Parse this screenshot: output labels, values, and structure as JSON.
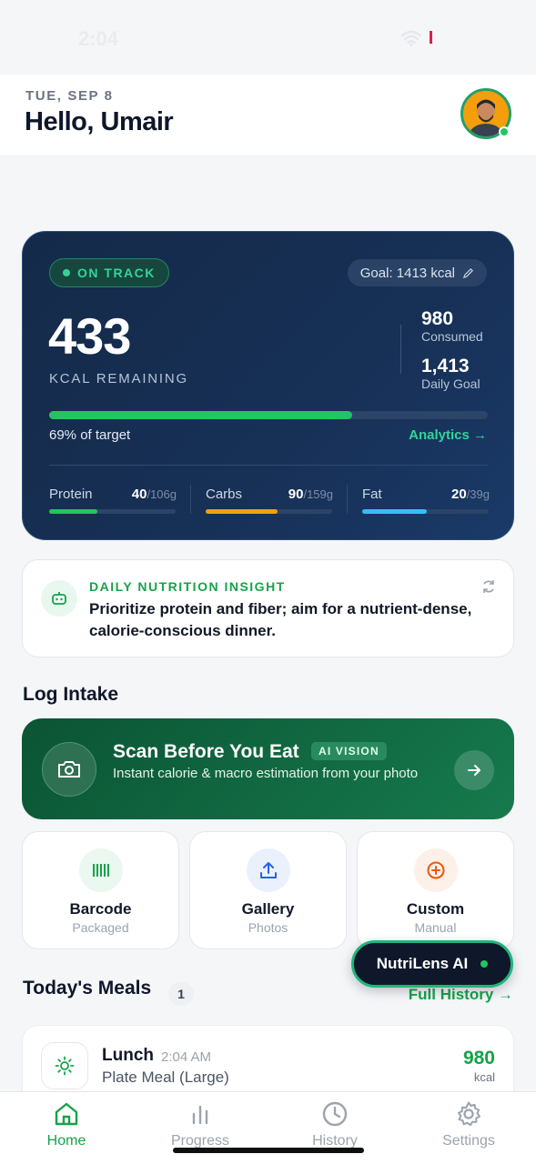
{
  "status": {
    "time": "2:04"
  },
  "header": {
    "date": "TUE, SEP 8",
    "greeting": "Hello, Umair"
  },
  "summary": {
    "status_badge": "ON TRACK",
    "goal_chip": "Goal: 1413 kcal",
    "remaining": "433",
    "remaining_label": "KCAL REMAINING",
    "consumed_value": "980",
    "consumed_label": "Consumed",
    "goal_value": "1,413",
    "goal_label": "Daily Goal",
    "progress_fraction": 0.69,
    "progress_label": "69% of target",
    "analytics_link": "Analytics →",
    "macros": [
      {
        "name": "Protein",
        "value": "40",
        "target": "/106g",
        "fraction": 0.38,
        "color": "#22c55e"
      },
      {
        "name": "Carbs",
        "value": "90",
        "target": "/159g",
        "fraction": 0.57,
        "color": "#f59e0b"
      },
      {
        "name": "Fat",
        "value": "20",
        "target": "/39g",
        "fraction": 0.51,
        "color": "#38bdf8"
      }
    ]
  },
  "insight": {
    "title": "DAILY NUTRITION INSIGHT",
    "text": "Prioritize protein and fiber; aim for a nutrient-dense, calorie-conscious dinner."
  },
  "log_intake": {
    "title": "Log Intake",
    "scan_title": "Scan Before You Eat",
    "scan_badge": "AI VISION",
    "scan_subtitle": "Instant calorie & macro estimation from your photo",
    "options": [
      {
        "title": "Barcode",
        "subtitle": "Packaged",
        "icon": "barcode-icon",
        "bg": "#eaf8ef",
        "color": "#16a34a"
      },
      {
        "title": "Gallery",
        "subtitle": "Photos",
        "icon": "upload-icon",
        "bg": "#eaf1fd",
        "color": "#2563eb"
      },
      {
        "title": "Custom",
        "subtitle": "Manual",
        "icon": "plus-circle-icon",
        "bg": "#fdf0e8",
        "color": "#ea580c"
      }
    ]
  },
  "assistant_button": "NutriLens AI",
  "meals": {
    "title": "Today's Meals",
    "count": "1",
    "history_link": "Full History →",
    "items": [
      {
        "name": "Lunch",
        "time": "2:04 AM",
        "description": "Plate Meal (Large)",
        "kcal": "980",
        "unit": "kcal"
      }
    ]
  },
  "tabs": [
    {
      "label": "Home",
      "icon": "home-icon",
      "active": true
    },
    {
      "label": "Progress",
      "icon": "bar-chart-icon",
      "active": false
    },
    {
      "label": "History",
      "icon": "clock-icon",
      "active": false
    },
    {
      "label": "Settings",
      "icon": "gear-icon",
      "active": false
    }
  ]
}
